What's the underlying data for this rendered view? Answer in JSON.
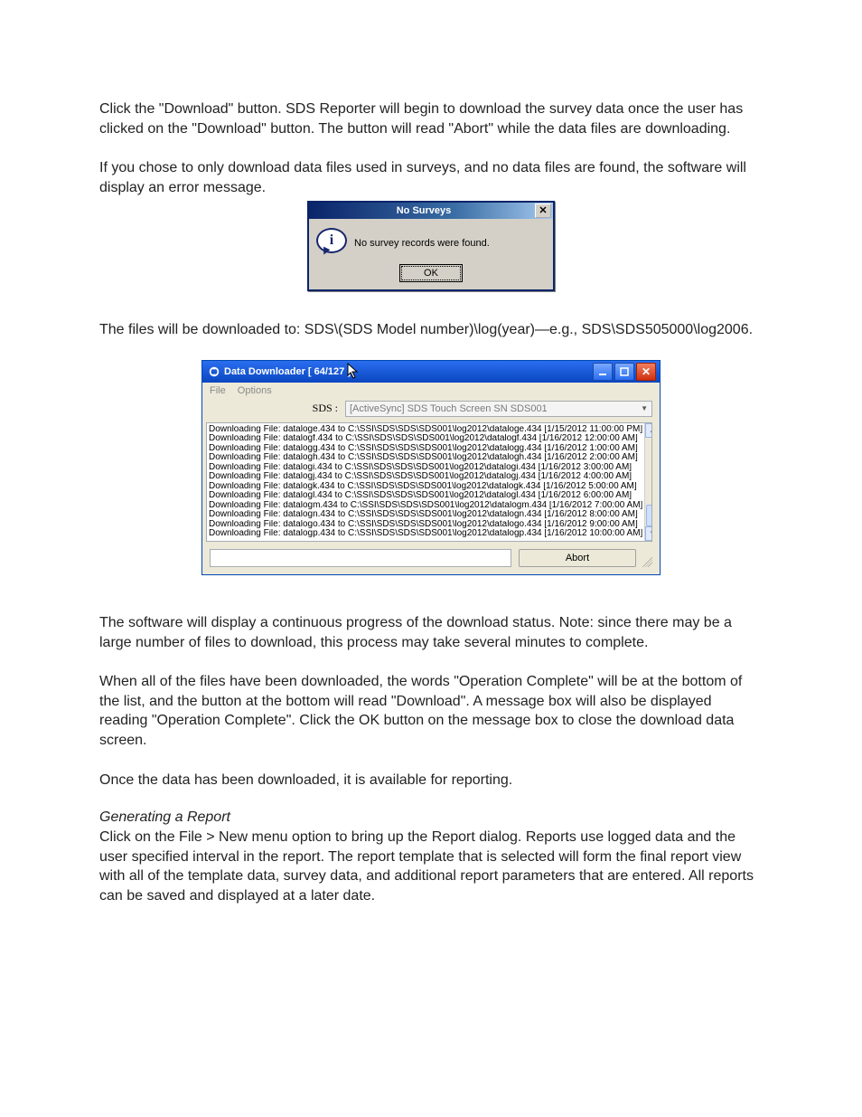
{
  "body": {
    "p1": "Click the \"Download\" button. SDS Reporter will begin to download the survey data once the user has clicked on the \"Download\" button. The button will read \"Abort\" while the data files are downloading.",
    "p2": "If you chose to only download data files used in surveys, and no data files are found, the software will display an error message.",
    "p3": "The files will be downloaded to: SDS\\(SDS Model number)\\log(year)—e.g., SDS\\SDS505000\\log2006.",
    "p4": "The software will display a continuous progress of the download status.  Note: since there may be a large number of files to download, this process may take several minutes to complete.",
    "p5": "When all of the files have been downloaded, the words \"Operation Complete\" will be at the bottom of the list, and the button at the bottom will read \"Download\".  A message box will also be displayed reading \"Operation Complete\".  Click the OK button on the message box to close the download data screen.",
    "p6": "Once the data has been downloaded, it is available for reporting.",
    "h1": "Generating a Report",
    "p7": "Click on the File > New menu option to bring up the Report dialog.  Reports use logged data and the user specified interval in the report.   The report template that is selected will form the final report view with all of the template data, survey data, and additional report parameters that are entered. All reports can be saved and displayed at a later date."
  },
  "dlg1": {
    "title": "No Surveys",
    "message": "No survey records were found.",
    "ok": "OK"
  },
  "dlg2": {
    "title": "Data Downloader [  64/127 ]",
    "menu": {
      "file": "File",
      "options": "Options"
    },
    "sds_label": "SDS :",
    "sds_value": "[ActiveSync] SDS Touch Screen SN SDS001",
    "log": [
      "Downloading File: dataloge.434 to C:\\SSI\\SDS\\SDS\\SDS001\\log2012\\dataloge.434 [1/15/2012 11:00:00 PM]",
      "Downloading File: datalogf.434 to C:\\SSI\\SDS\\SDS\\SDS001\\log2012\\datalogf.434 [1/16/2012 12:00:00 AM]",
      "Downloading File: datalogg.434 to C:\\SSI\\SDS\\SDS\\SDS001\\log2012\\datalogg.434 [1/16/2012 1:00:00 AM]",
      "Downloading File: datalogh.434 to C:\\SSI\\SDS\\SDS\\SDS001\\log2012\\datalogh.434 [1/16/2012 2:00:00 AM]",
      "Downloading File: datalogi.434 to C:\\SSI\\SDS\\SDS\\SDS001\\log2012\\datalogi.434 [1/16/2012 3:00:00 AM]",
      "Downloading File: datalogj.434 to C:\\SSI\\SDS\\SDS\\SDS001\\log2012\\datalogj.434 [1/16/2012 4:00:00 AM]",
      "Downloading File: datalogk.434 to C:\\SSI\\SDS\\SDS\\SDS001\\log2012\\datalogk.434 [1/16/2012 5:00:00 AM]",
      "Downloading File: datalogl.434 to C:\\SSI\\SDS\\SDS\\SDS001\\log2012\\datalogl.434 [1/16/2012 6:00:00 AM]",
      "Downloading File: datalogm.434 to C:\\SSI\\SDS\\SDS\\SDS001\\log2012\\datalogm.434 [1/16/2012 7:00:00 AM]",
      "Downloading File: datalogn.434 to C:\\SSI\\SDS\\SDS\\SDS001\\log2012\\datalogn.434 [1/16/2012 8:00:00 AM]",
      "Downloading File: datalogo.434 to C:\\SSI\\SDS\\SDS\\SDS001\\log2012\\datalogo.434 [1/16/2012 9:00:00 AM]",
      "Downloading File: datalogp.434 to C:\\SSI\\SDS\\SDS\\SDS001\\log2012\\datalogp.434 [1/16/2012 10:00:00 AM]"
    ],
    "abort": "Abort"
  }
}
